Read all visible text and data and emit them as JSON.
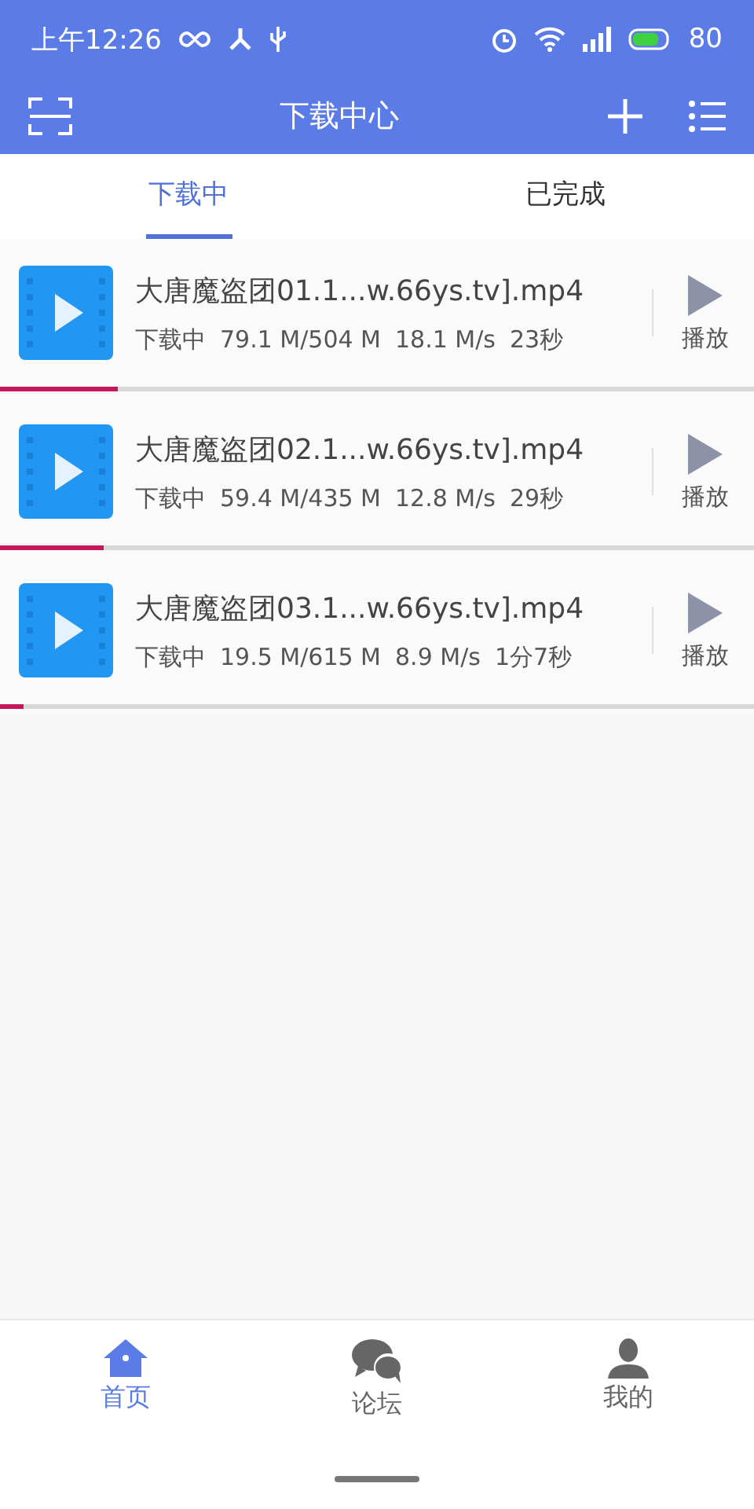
{
  "status_bar": {
    "time": "上午12:26",
    "battery": "80"
  },
  "header": {
    "title": "下载中心"
  },
  "tabs": [
    {
      "label": "下载中",
      "selected": true
    },
    {
      "label": "已完成",
      "selected": false
    }
  ],
  "downloads": [
    {
      "name": "大唐魔盗团01.1...w.66ys.tv].mp4",
      "status": "下载中",
      "size": "79.1 M/504 M",
      "speed": "18.1 M/s",
      "remaining": "23秒",
      "action": "播放",
      "level": 0.157
    },
    {
      "name": "大唐魔盗团02.1...w.66ys.tv].mp4",
      "status": "下载中",
      "size": "59.4 M/435 M",
      "speed": "12.8 M/s",
      "remaining": "29秒",
      "action": "播放",
      "level": 0.137
    },
    {
      "name": "大唐魔盗团03.1...w.66ys.tv].mp4",
      "status": "下载中",
      "size": "19.5 M/615 M",
      "speed": "8.9 M/s",
      "remaining": "1分7秒",
      "action": "播放",
      "level": 0.032
    }
  ],
  "bottom_nav": [
    {
      "label": "首页",
      "kind": "home",
      "selected": true
    },
    {
      "label": "论坛",
      "kind": "forum",
      "selected": false
    },
    {
      "label": "我的",
      "kind": "profile",
      "selected": false
    }
  ]
}
